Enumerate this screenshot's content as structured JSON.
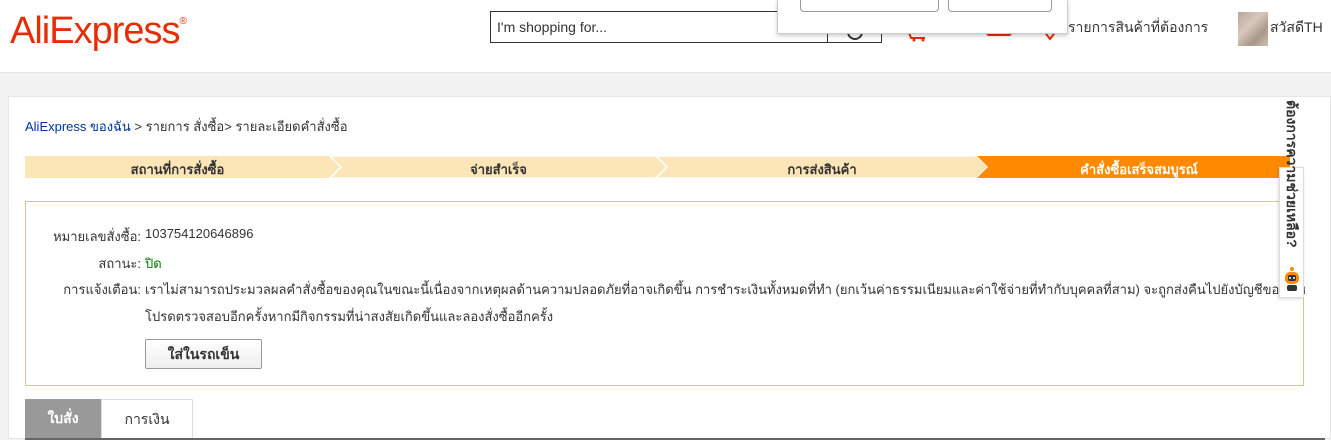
{
  "header": {
    "logo_text": "AliExpress",
    "logo_mark": "®",
    "search_placeholder": "I'm shopping for...",
    "wishlist_label": "รายการสินค้าที่ต้องการ",
    "greeting": "สวัสดีTH",
    "brand_color": "#e62e04"
  },
  "breadcrumb": {
    "home": "AliExpress ของฉัน",
    "sep1": " > ",
    "orders": "รายการ สั่งซื้อ",
    "sep2": "> ",
    "current": "รายละเอียดคำสั่งซื้อ"
  },
  "steps": {
    "items": [
      "สถานที่การสั่งซื้อ",
      "จ่ายสำเร็จ",
      "การส่งสินค้า",
      "คำสั่งซื้อเสร็จสมบูรณ์"
    ],
    "active_index": 3,
    "inactive_color": "#fce6b8",
    "active_color": "#ff8a00"
  },
  "order": {
    "number_label": "หมายเลขสั่งซื้อ:",
    "number_value": "103754120646896",
    "status_label": "สถานะ:",
    "status_value": "ปิด",
    "notice_label": "การแจ้งเตือน:",
    "notice_line1": "เราไม่สามารถประมวลผลคำสั่งซื้อของคุณในขณะนี้เนื่องจากเหตุผลด้านความปลอดภัยที่อาจเกิดขึ้น การชำระเงินทั้งหมดที่ทำ (ยกเว้นค่าธรรมเนียมและค่าใช้จ่ายที่ทำกับบุคคลที่สาม) จะถูกส่งคืนไปยังบัญชีของคุณ",
    "notice_line2": "โปรดตรวจสอบอีกครั้งหากมีกิจกรรมที่น่าสงสัยเกิดขึ้นและลองสั่งซื้ออีกครั้ง",
    "cart_button": "ใส่ในรถเข็น"
  },
  "tabs": {
    "active": "ใบสั่ง",
    "inactive": "การเงิน"
  },
  "side_help": {
    "label": "ต้องการความช่วยเหลือ?"
  }
}
